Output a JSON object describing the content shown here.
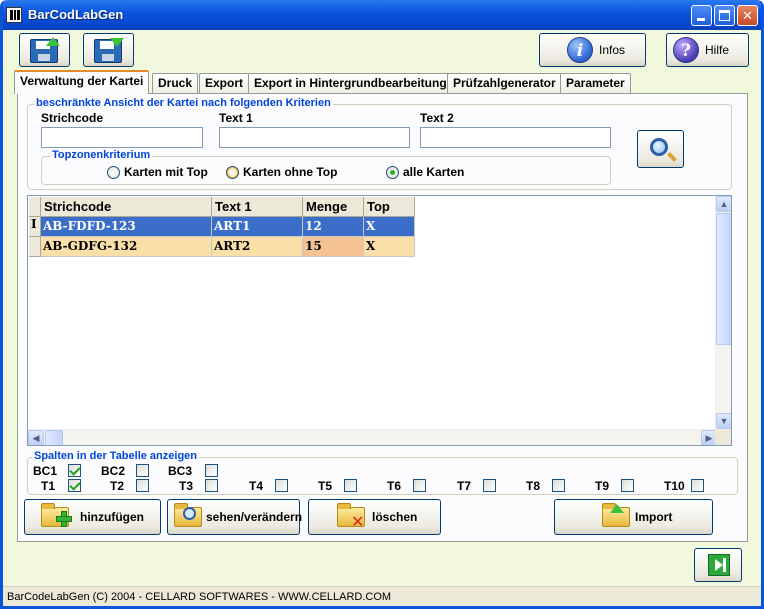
{
  "window": {
    "title": "BarCodLabGen"
  },
  "toolbar": {
    "infos_label": "Infos",
    "hilfe_label": "Hilfe"
  },
  "tabs": [
    {
      "label": "Verwaltung der Kartei",
      "active": true
    },
    {
      "label": "Druck"
    },
    {
      "label": "Export"
    },
    {
      "label": "Export in Hintergrundbearbeitung"
    },
    {
      "label": "Prüfzahlgenerator"
    },
    {
      "label": "Parameter"
    }
  ],
  "filter": {
    "legend": "beschränkte Ansicht der Kartei nach folgenden Kriterien",
    "strichcode_label": "Strichcode",
    "text1_label": "Text 1",
    "text2_label": "Text 2",
    "strichcode_value": "",
    "text1_value": "",
    "text2_value": "",
    "topzone": {
      "legend": "Topzonenkriterium",
      "options": [
        {
          "label": "Karten mit Top",
          "checked": false
        },
        {
          "label": "Karten ohne Top",
          "checked": false
        },
        {
          "label": "alle Karten",
          "checked": true
        }
      ]
    }
  },
  "grid": {
    "columns": [
      "Strichcode",
      "Text 1",
      "Menge",
      "Top"
    ],
    "rows": [
      {
        "indicator": "I",
        "cells": [
          "AB-FDFD-123",
          "ART1",
          "12",
          "X"
        ],
        "selected": true
      },
      {
        "indicator": "",
        "cells": [
          "AB-GDFG-132",
          "ART2",
          "15",
          "X"
        ],
        "selected": false
      }
    ]
  },
  "columns_group": {
    "legend": "Spalten in der Tabelle anzeigen",
    "row1": [
      {
        "label": "BC1",
        "checked": true
      },
      {
        "label": "BC2",
        "checked": false
      },
      {
        "label": "BC3",
        "checked": false
      }
    ],
    "row2": [
      {
        "label": "T1",
        "checked": true
      },
      {
        "label": "T2",
        "checked": false
      },
      {
        "label": "T3",
        "checked": false
      },
      {
        "label": "T4",
        "checked": false
      },
      {
        "label": "T5",
        "checked": false
      },
      {
        "label": "T6",
        "checked": false
      },
      {
        "label": "T7",
        "checked": false
      },
      {
        "label": "T8",
        "checked": false
      },
      {
        "label": "T9",
        "checked": false
      },
      {
        "label": "T10",
        "checked": false
      }
    ]
  },
  "actions": {
    "add_label": "hinzufügen",
    "view_label": "sehen/verändern",
    "delete_label": "löschen",
    "import_label": "Import"
  },
  "status": {
    "text": "BarCodeLabGen (C) 2004 - CELLARD SOFTWARES - WWW.CELLARD.COM"
  },
  "colors": {
    "title_bar": "#0a55e0",
    "window_bg": "#f1f8dc",
    "tab_accent": "#e68b2c",
    "legend_text": "#0046d5",
    "selected_row": "#3a6ec9",
    "alt_row": "#fae0a8"
  },
  "icons": {
    "save_up": "disk-upload-icon",
    "save_down": "disk-download-icon",
    "info": "info-icon",
    "help": "help-icon",
    "search": "magnifier-icon",
    "add": "folder-plus-icon",
    "view": "folder-magnifier-icon",
    "delete": "folder-delete-icon",
    "import": "folder-import-icon",
    "exit": "exit-icon"
  }
}
